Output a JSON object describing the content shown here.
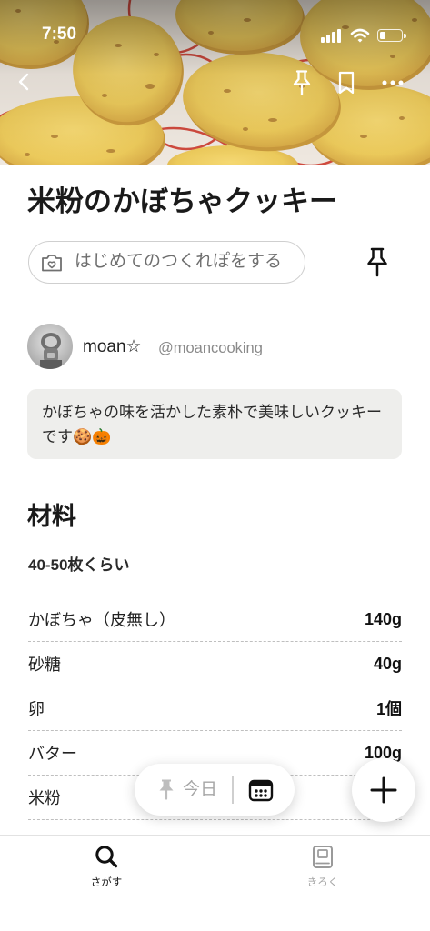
{
  "status_bar": {
    "time": "7:50",
    "icons": [
      "signal-icon",
      "wifi-icon",
      "battery-icon"
    ],
    "battery_level": 0.25
  },
  "nav": {
    "icons": [
      "back-icon",
      "pin-icon",
      "bookmark-icon",
      "more-icon"
    ]
  },
  "recipe": {
    "title": "米粉のかぼちゃクッキー",
    "cooksnap_button_label": "はじめてのつくれぽをする",
    "author": {
      "name": "moan☆",
      "handle": "@moancooking"
    },
    "description": "かぼちゃの味を活かした素朴で美味しいクッキーです🍪🎃"
  },
  "ingredients": {
    "heading": "材料",
    "servings": "40-50枚くらい",
    "items": [
      {
        "name": "かぼちゃ（皮無し）",
        "amount": "140g"
      },
      {
        "name": "砂糖",
        "amount": "40g"
      },
      {
        "name": "卵",
        "amount": "1個"
      },
      {
        "name": "バター",
        "amount": "100g"
      },
      {
        "name": "米粉"
      }
    ]
  },
  "today_pill": {
    "label": "今日",
    "icons": [
      "pin-icon",
      "calendar-icon"
    ]
  },
  "fab": {
    "icon": "plus-icon"
  },
  "tab_bar": {
    "items": [
      {
        "label": "さがす",
        "icon": "search-icon",
        "active": true
      },
      {
        "label": "きろく",
        "icon": "book-icon",
        "active": false
      }
    ]
  },
  "colors": {
    "text": "#1f1f1f",
    "muted": "#6e6e6e",
    "inactive": "#a6a6a6",
    "description_bg": "#eeeeec"
  }
}
